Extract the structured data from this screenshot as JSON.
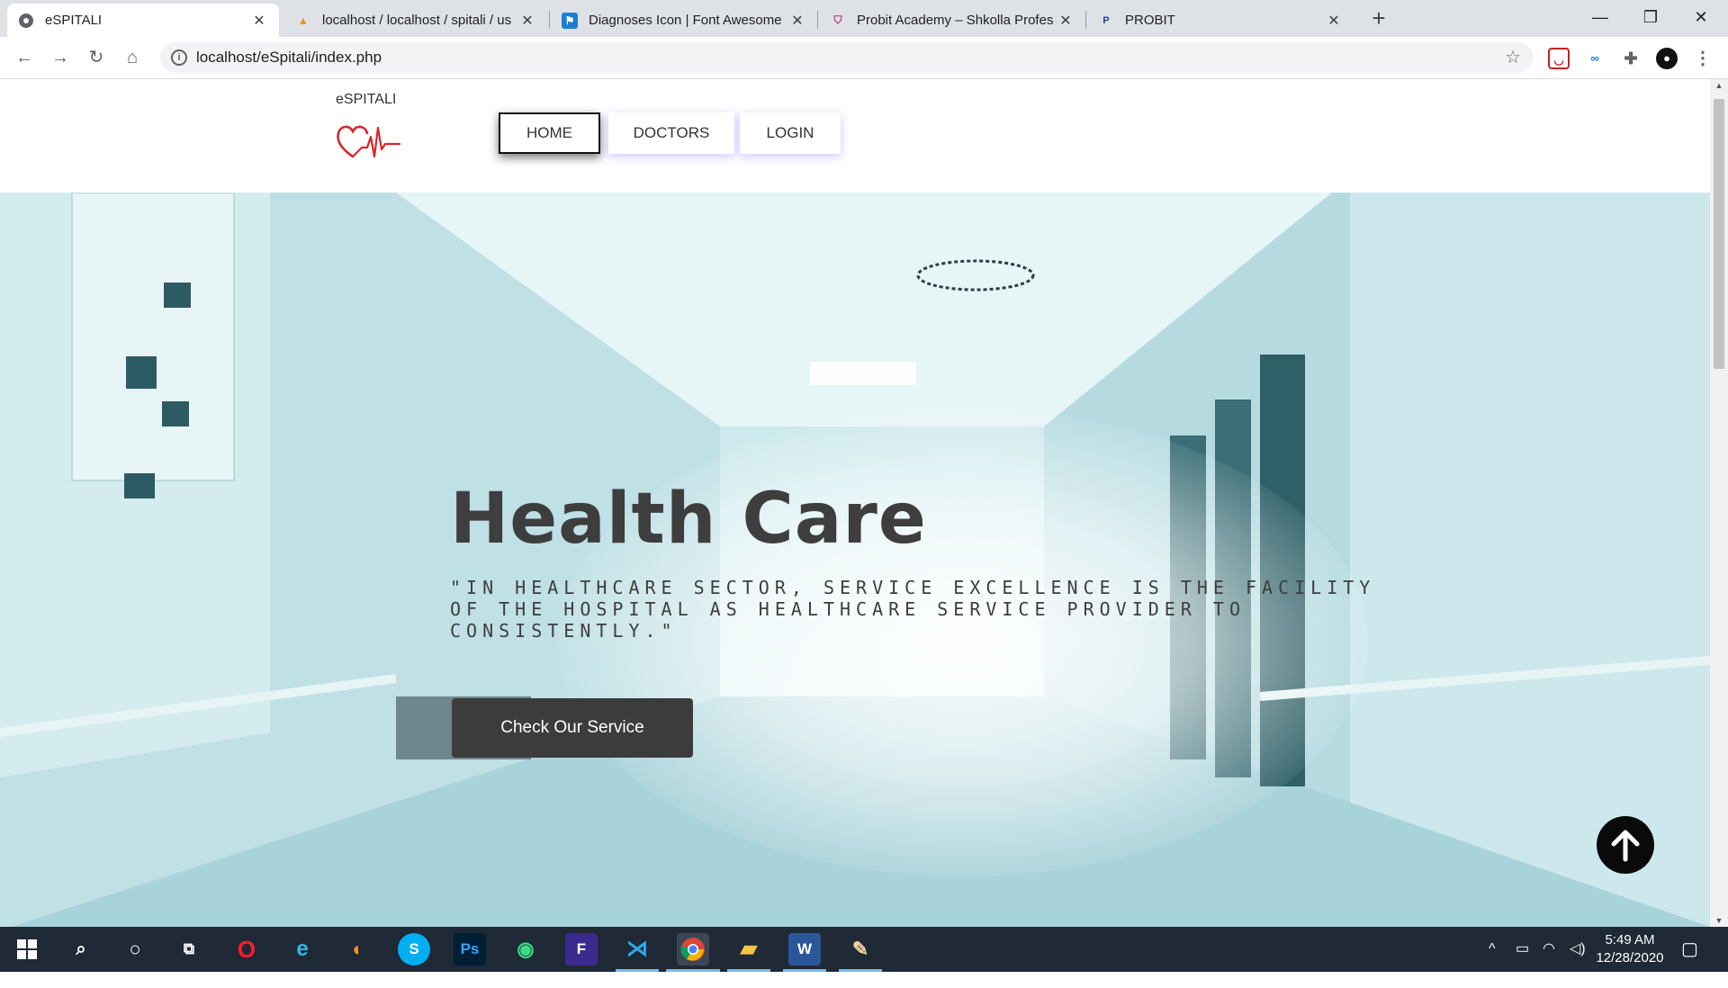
{
  "browser": {
    "tabs": [
      {
        "title": "eSPITALI",
        "active": true
      },
      {
        "title": "localhost / localhost / spitali / us",
        "active": false
      },
      {
        "title": "Diagnoses Icon | Font Awesome",
        "active": false
      },
      {
        "title": "Probit Academy – Shkolla Profes",
        "active": false
      },
      {
        "title": "PROBIT",
        "active": false
      }
    ],
    "new_tab_glyph": "+",
    "url": "localhost/eSpitali/index.php"
  },
  "site": {
    "brand": "eSPITALI",
    "nav": {
      "home": "HOME",
      "doctors": "DOCTORS",
      "login": "LOGIN"
    }
  },
  "hero": {
    "title": "Health Care",
    "quote": "\"In healthcare sector, service excellence is the facility of the hospital as healthcare service provider to consistently.\"",
    "cta": "Check Our Service"
  },
  "taskbar": {
    "time": "5:49 AM",
    "date": "12/28/2020"
  },
  "colors": {
    "accent_dark": "#3c3c3c",
    "heart_red": "#d9252a",
    "nav_glow": "#785aff"
  }
}
